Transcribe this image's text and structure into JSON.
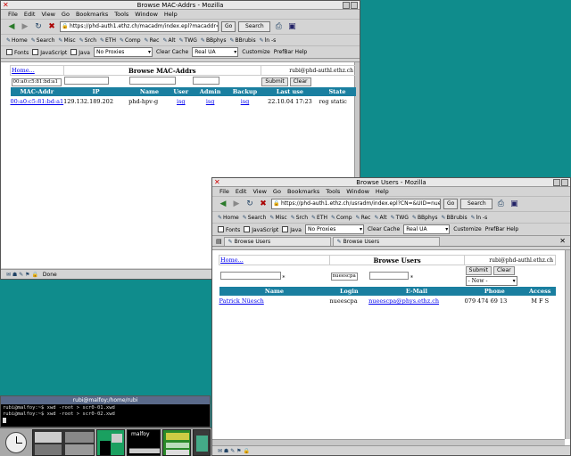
{
  "win1": {
    "title": "Browse MAC-Addrs - Mozilla",
    "menu": [
      "File",
      "Edit",
      "View",
      "Go",
      "Bookmarks",
      "Tools",
      "Window",
      "Help"
    ],
    "url": "https://phd-auth1.ethz.ch/macadm/index.epl?macaddr=00%3A0",
    "go": "Go",
    "search": "Search",
    "bookmarks": [
      "Home",
      "Search",
      "Misc",
      "Srch",
      "ETH",
      "Comp",
      "Rec",
      "Alt",
      "TWG",
      "BBphys",
      "BBrubis",
      "ln -s"
    ],
    "pref": {
      "fonts": "Fonts",
      "js": "JavaScript",
      "java": "Java",
      "proxy": "No Proxies",
      "clear": "Clear Cache",
      "ua": "Real UA",
      "customize": "Customize",
      "help": "PrefBar Help"
    },
    "page": {
      "home": "Home...",
      "heading": "Browse MAC-Addrs",
      "user": "rubi@phd-authl.ethz.ch",
      "search_value": "00:a0:c5:81:bd:a1",
      "submit": "Submit",
      "clear": "Clear",
      "columns": [
        "MAC-Addr",
        "IP",
        "Name",
        "User",
        "Admin",
        "Backup",
        "Last use",
        "State"
      ],
      "row": {
        "mac": "00:a0:c5:81:bd:a1",
        "ip": "129.132.189.202",
        "name": "phd-hpv-g",
        "user": "isg",
        "admin": "isg",
        "backup": "isg",
        "last": "22.10.04 17:23",
        "state": "reg static"
      }
    },
    "status": "Done"
  },
  "win2": {
    "title": "Browse Users - Mozilla",
    "menu": [
      "File",
      "Edit",
      "View",
      "Go",
      "Bookmarks",
      "Tools",
      "Window",
      "Help"
    ],
    "url": "https://phd-auth1.ethz.ch/usradm/index.epl?CN=&UID=nueescp",
    "go": "Go",
    "search": "Search",
    "bookmarks": [
      "Home",
      "Search",
      "Misc",
      "Srch",
      "ETH",
      "Comp",
      "Rec",
      "Alt",
      "TWG",
      "BBphys",
      "BBrubis",
      "ln -s"
    ],
    "pref": {
      "fonts": "Fonts",
      "js": "JavaScript",
      "java": "Java",
      "proxy": "No Proxies",
      "clear": "Clear Cache",
      "ua": "Real UA",
      "customize": "Customize",
      "help": "PrefBar Help"
    },
    "tabs": [
      "Browse Users",
      "Browse Users"
    ],
    "page": {
      "home": "Home...",
      "heading": "Browse Users",
      "user": "rubi@phd-authl.ethz.ch",
      "login_value": "nueescpa",
      "new_option": "- New -",
      "submit": "Submit",
      "clear": "Clear",
      "columns": [
        "Name",
        "Login",
        "E-Mail",
        "Phone",
        "Access"
      ],
      "row": {
        "name": "Patrick Nüesch",
        "login": "nueescpa",
        "email": "nueescpa@phys.ethz.ch",
        "phone": "079 474 69 13",
        "access": "M F S"
      }
    }
  },
  "terminal": {
    "title": "rubi@malfoy:/home/rubi",
    "lines": [
      "rubi@malfoy:~$ xwd -root > scr0-01.xwd",
      "rubi@malfoy:~$ xwd -root > scr0-02.xwd"
    ]
  },
  "dock": {
    "monitor_label": "malfoy"
  }
}
